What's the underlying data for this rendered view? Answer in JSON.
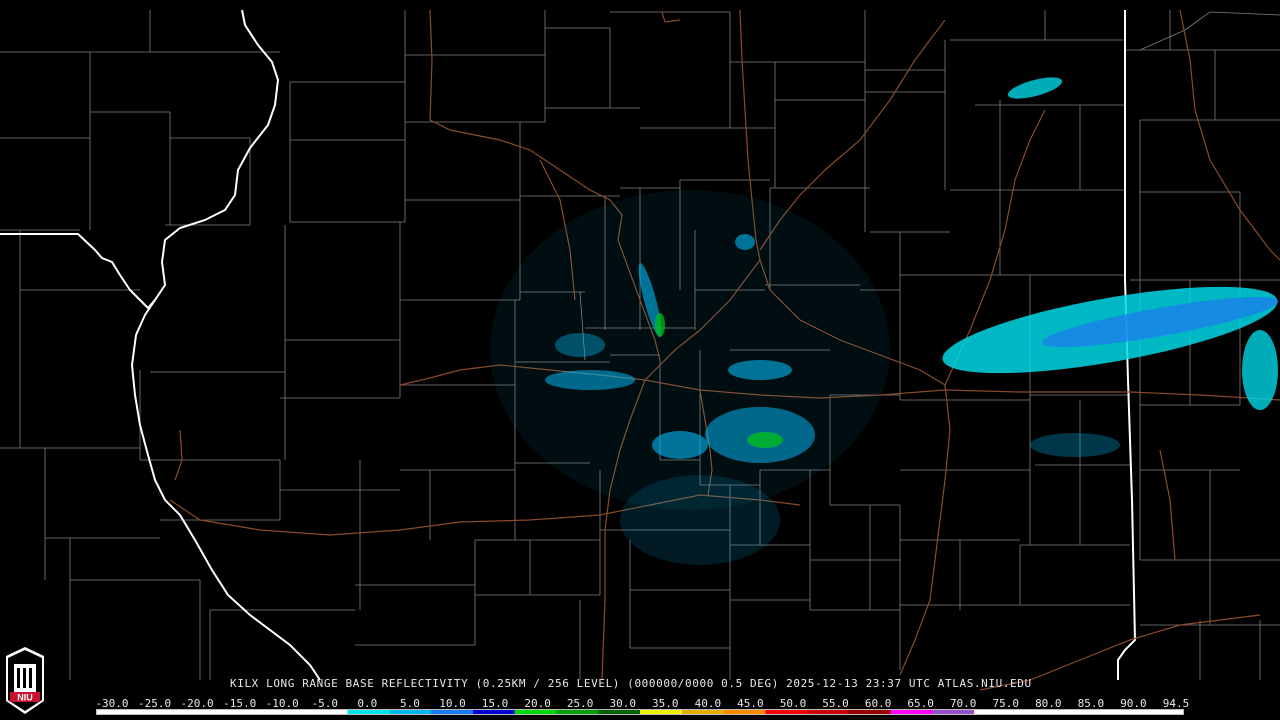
{
  "product": {
    "title": "KILX LONG RANGE BASE REFLECTIVITY (0.25KM / 256 LEVEL) (000000/0000 0.5 DEG) 2025-12-13 23:37 UTC  ATLAS.NIU.EDU",
    "logo_text": "NIU"
  },
  "scale": {
    "ticks": [
      "-30.0",
      "-25.0",
      "-20.0",
      "-15.0",
      "-10.0",
      "-5.0",
      "0.0",
      "5.0",
      "10.0",
      "15.0",
      "20.0",
      "25.0",
      "30.0",
      "35.0",
      "40.0",
      "45.0",
      "50.0",
      "55.0",
      "60.0",
      "65.0",
      "70.0",
      "75.0",
      "80.0",
      "85.0",
      "90.0",
      "94.5"
    ],
    "colors": [
      "#ffffff",
      "#ffffff",
      "#ffffff",
      "#ffffff",
      "#ffffff",
      "#ffffff",
      "#00e5e5",
      "#00b7f0",
      "#1e78f0",
      "#0000d0",
      "#00d800",
      "#00a000",
      "#006400",
      "#f0f000",
      "#e0b000",
      "#ff8c00",
      "#ff0000",
      "#c80000",
      "#960000",
      "#ff00ff",
      "#9650c8",
      "#ffffff",
      "#ffffff",
      "#ffffff",
      "#ffffff",
      "#ffffff"
    ]
  },
  "colors": {
    "background": "#000000",
    "county_lines": "#7f7f7f",
    "state_lines": "#ffffff",
    "highways": "#8b4a2a"
  }
}
